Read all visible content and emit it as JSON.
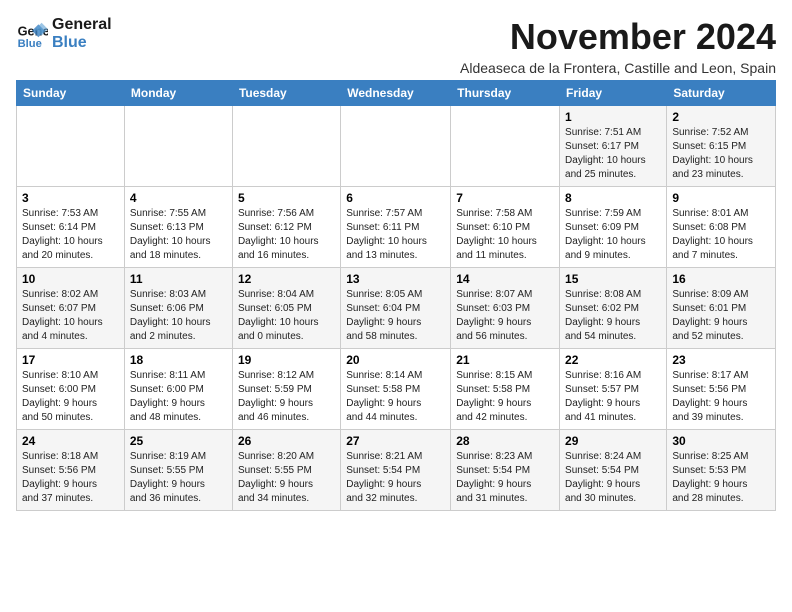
{
  "logo": {
    "line1": "General",
    "line2": "Blue"
  },
  "title": "November 2024",
  "subtitle": "Aldeaseca de la Frontera, Castille and Leon, Spain",
  "weekdays": [
    "Sunday",
    "Monday",
    "Tuesday",
    "Wednesday",
    "Thursday",
    "Friday",
    "Saturday"
  ],
  "weeks": [
    [
      {
        "day": "",
        "info": ""
      },
      {
        "day": "",
        "info": ""
      },
      {
        "day": "",
        "info": ""
      },
      {
        "day": "",
        "info": ""
      },
      {
        "day": "",
        "info": ""
      },
      {
        "day": "1",
        "info": "Sunrise: 7:51 AM\nSunset: 6:17 PM\nDaylight: 10 hours\nand 25 minutes."
      },
      {
        "day": "2",
        "info": "Sunrise: 7:52 AM\nSunset: 6:15 PM\nDaylight: 10 hours\nand 23 minutes."
      }
    ],
    [
      {
        "day": "3",
        "info": "Sunrise: 7:53 AM\nSunset: 6:14 PM\nDaylight: 10 hours\nand 20 minutes."
      },
      {
        "day": "4",
        "info": "Sunrise: 7:55 AM\nSunset: 6:13 PM\nDaylight: 10 hours\nand 18 minutes."
      },
      {
        "day": "5",
        "info": "Sunrise: 7:56 AM\nSunset: 6:12 PM\nDaylight: 10 hours\nand 16 minutes."
      },
      {
        "day": "6",
        "info": "Sunrise: 7:57 AM\nSunset: 6:11 PM\nDaylight: 10 hours\nand 13 minutes."
      },
      {
        "day": "7",
        "info": "Sunrise: 7:58 AM\nSunset: 6:10 PM\nDaylight: 10 hours\nand 11 minutes."
      },
      {
        "day": "8",
        "info": "Sunrise: 7:59 AM\nSunset: 6:09 PM\nDaylight: 10 hours\nand 9 minutes."
      },
      {
        "day": "9",
        "info": "Sunrise: 8:01 AM\nSunset: 6:08 PM\nDaylight: 10 hours\nand 7 minutes."
      }
    ],
    [
      {
        "day": "10",
        "info": "Sunrise: 8:02 AM\nSunset: 6:07 PM\nDaylight: 10 hours\nand 4 minutes."
      },
      {
        "day": "11",
        "info": "Sunrise: 8:03 AM\nSunset: 6:06 PM\nDaylight: 10 hours\nand 2 minutes."
      },
      {
        "day": "12",
        "info": "Sunrise: 8:04 AM\nSunset: 6:05 PM\nDaylight: 10 hours\nand 0 minutes."
      },
      {
        "day": "13",
        "info": "Sunrise: 8:05 AM\nSunset: 6:04 PM\nDaylight: 9 hours\nand 58 minutes."
      },
      {
        "day": "14",
        "info": "Sunrise: 8:07 AM\nSunset: 6:03 PM\nDaylight: 9 hours\nand 56 minutes."
      },
      {
        "day": "15",
        "info": "Sunrise: 8:08 AM\nSunset: 6:02 PM\nDaylight: 9 hours\nand 54 minutes."
      },
      {
        "day": "16",
        "info": "Sunrise: 8:09 AM\nSunset: 6:01 PM\nDaylight: 9 hours\nand 52 minutes."
      }
    ],
    [
      {
        "day": "17",
        "info": "Sunrise: 8:10 AM\nSunset: 6:00 PM\nDaylight: 9 hours\nand 50 minutes."
      },
      {
        "day": "18",
        "info": "Sunrise: 8:11 AM\nSunset: 6:00 PM\nDaylight: 9 hours\nand 48 minutes."
      },
      {
        "day": "19",
        "info": "Sunrise: 8:12 AM\nSunset: 5:59 PM\nDaylight: 9 hours\nand 46 minutes."
      },
      {
        "day": "20",
        "info": "Sunrise: 8:14 AM\nSunset: 5:58 PM\nDaylight: 9 hours\nand 44 minutes."
      },
      {
        "day": "21",
        "info": "Sunrise: 8:15 AM\nSunset: 5:58 PM\nDaylight: 9 hours\nand 42 minutes."
      },
      {
        "day": "22",
        "info": "Sunrise: 8:16 AM\nSunset: 5:57 PM\nDaylight: 9 hours\nand 41 minutes."
      },
      {
        "day": "23",
        "info": "Sunrise: 8:17 AM\nSunset: 5:56 PM\nDaylight: 9 hours\nand 39 minutes."
      }
    ],
    [
      {
        "day": "24",
        "info": "Sunrise: 8:18 AM\nSunset: 5:56 PM\nDaylight: 9 hours\nand 37 minutes."
      },
      {
        "day": "25",
        "info": "Sunrise: 8:19 AM\nSunset: 5:55 PM\nDaylight: 9 hours\nand 36 minutes."
      },
      {
        "day": "26",
        "info": "Sunrise: 8:20 AM\nSunset: 5:55 PM\nDaylight: 9 hours\nand 34 minutes."
      },
      {
        "day": "27",
        "info": "Sunrise: 8:21 AM\nSunset: 5:54 PM\nDaylight: 9 hours\nand 32 minutes."
      },
      {
        "day": "28",
        "info": "Sunrise: 8:23 AM\nSunset: 5:54 PM\nDaylight: 9 hours\nand 31 minutes."
      },
      {
        "day": "29",
        "info": "Sunrise: 8:24 AM\nSunset: 5:54 PM\nDaylight: 9 hours\nand 30 minutes."
      },
      {
        "day": "30",
        "info": "Sunrise: 8:25 AM\nSunset: 5:53 PM\nDaylight: 9 hours\nand 28 minutes."
      }
    ]
  ]
}
